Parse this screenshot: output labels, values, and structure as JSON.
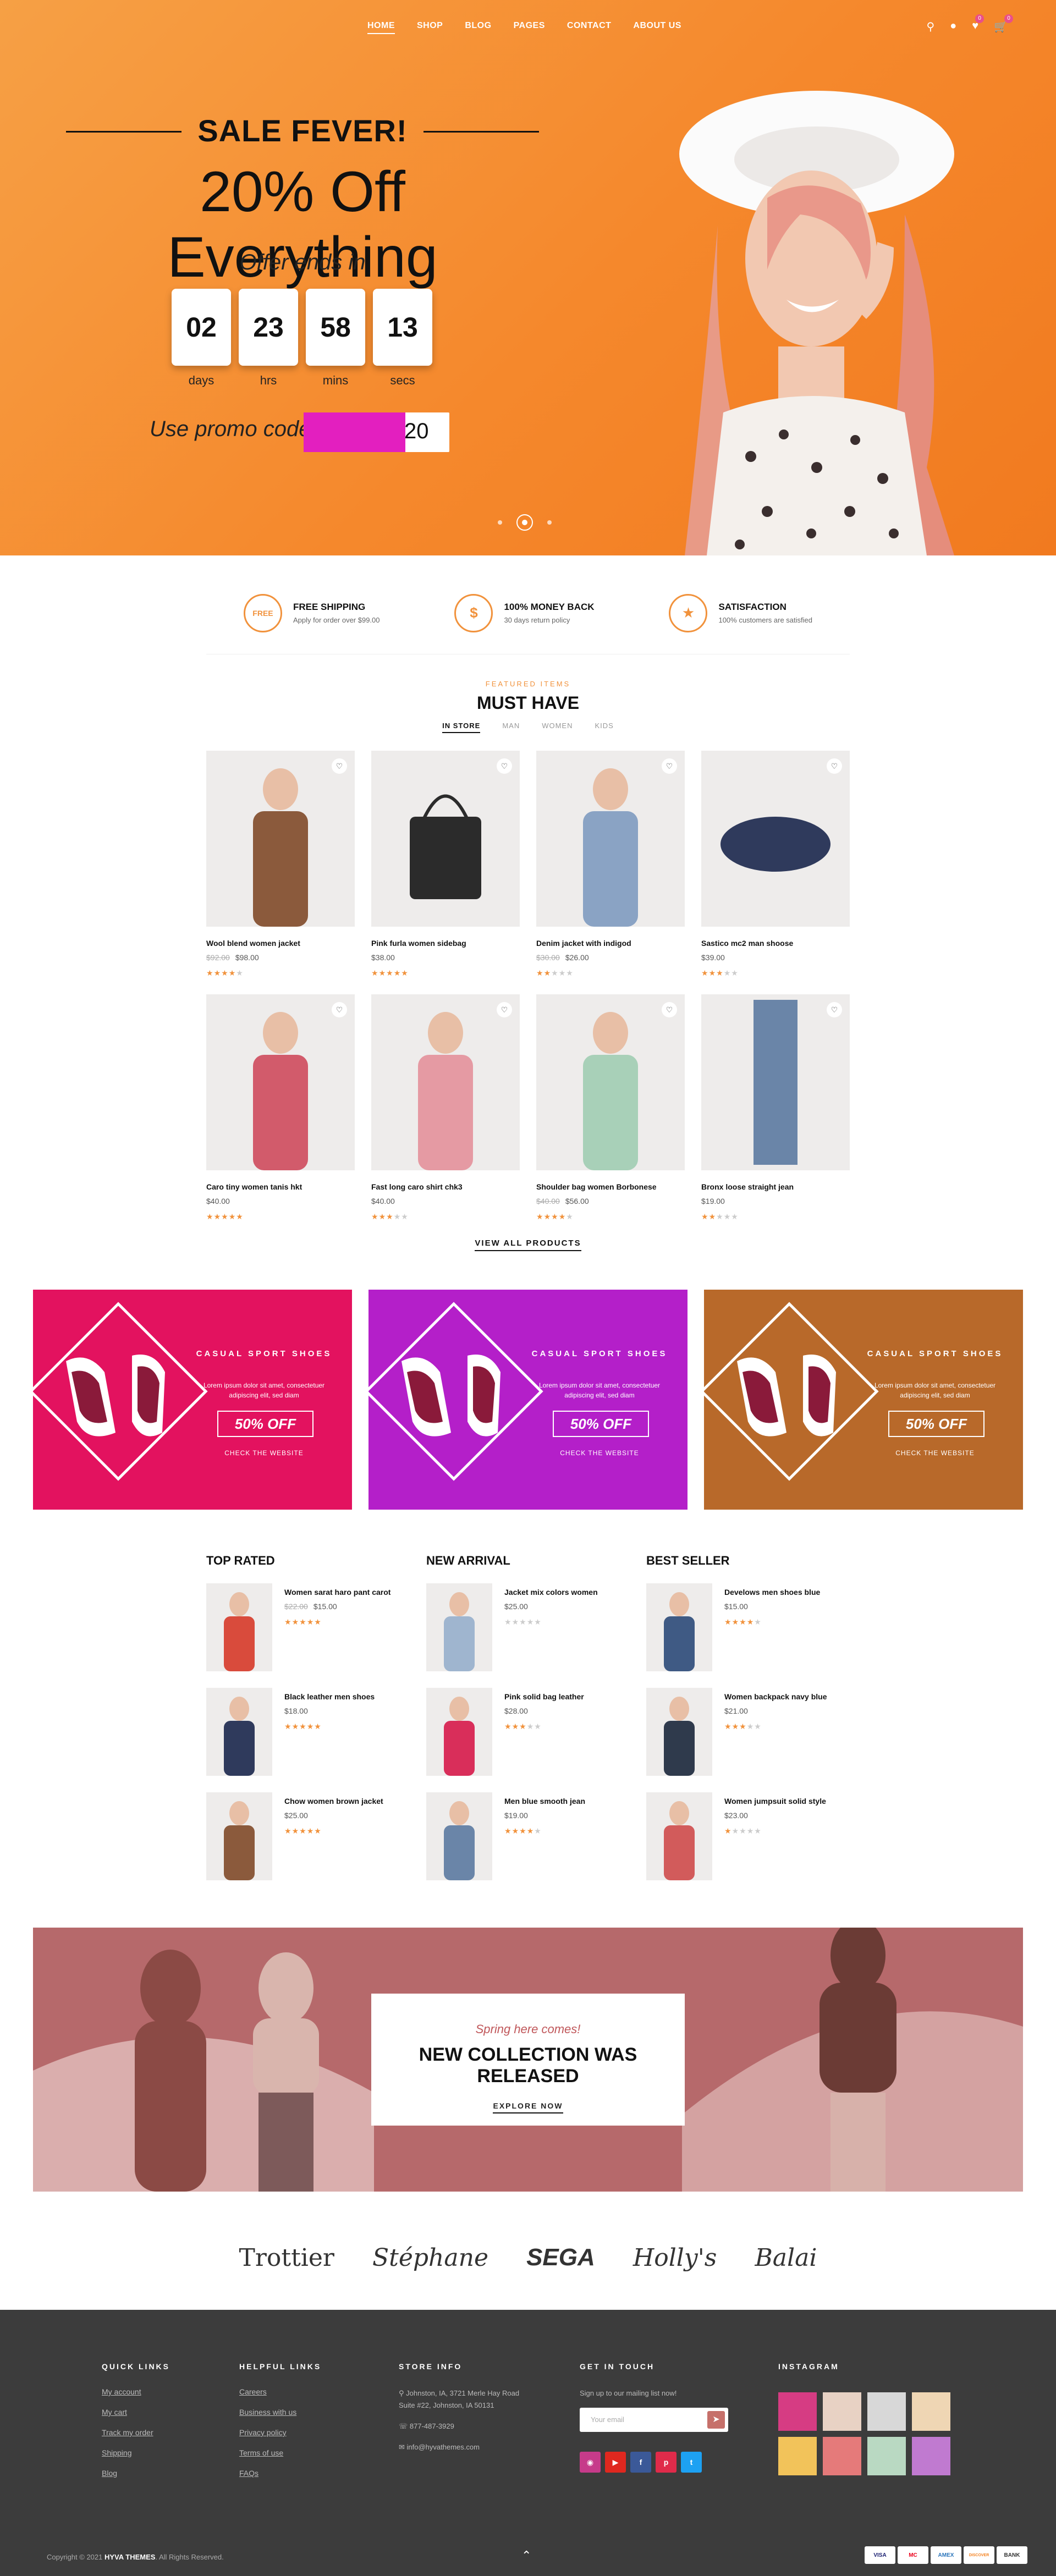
{
  "nav": {
    "links": [
      "HOME",
      "SHOP",
      "BLOG",
      "PAGES",
      "CONTACT",
      "ABOUT US"
    ],
    "cart_count": "0",
    "wish_count": "0"
  },
  "hero": {
    "title": "SALE FEVER!",
    "headline": "20% Off Everything",
    "offer": "Offer ends in",
    "countdown": [
      {
        "value": "02",
        "label": "days"
      },
      {
        "value": "23",
        "label": "hrs"
      },
      {
        "value": "58",
        "label": "mins"
      },
      {
        "value": "13",
        "label": "secs"
      }
    ],
    "promo_label": "Use promo code",
    "promo_value": "20"
  },
  "features": [
    {
      "title": "FREE SHIPPING",
      "sub": "Apply for order over $99.00",
      "icon": "FREE"
    },
    {
      "title": "100% MONEY BACK",
      "sub": "30 days return policy",
      "icon": "$"
    },
    {
      "title": "SATISFACTION",
      "sub": "100% customers are satisfied",
      "icon": "★"
    }
  ],
  "featured": {
    "sub": "FEATURED ITEMS",
    "title": "MUST HAVE",
    "tabs": [
      "IN STORE",
      "MAN",
      "WOMEN",
      "KIDS"
    ],
    "products": [
      {
        "name": "Wool blend women jacket",
        "old": "$92.00",
        "price": "$98.00",
        "rating": 4
      },
      {
        "name": "Pink furla women sidebag",
        "old": "",
        "price": "$38.00",
        "rating": 5
      },
      {
        "name": "Denim jacket with indigod",
        "old": "$30.00",
        "price": "$26.00",
        "rating": 2
      },
      {
        "name": "Sastico mc2 man shoose",
        "old": "",
        "price": "$39.00",
        "rating": 3
      },
      {
        "name": "Caro tiny women tanis hkt",
        "old": "",
        "price": "$40.00",
        "rating": 5
      },
      {
        "name": "Fast long caro shirt chk3",
        "old": "",
        "price": "$40.00",
        "rating": 3
      },
      {
        "name": "Shoulder bag women Borbonese",
        "old": "$40.00",
        "price": "$56.00",
        "rating": 4
      },
      {
        "name": "Bronx loose straight jean",
        "old": "",
        "price": "$19.00",
        "rating": 2
      }
    ],
    "view_all": "VIEW ALL PRODUCTS"
  },
  "banners": [
    {
      "kicker": "CASUAL SPORT SHOES",
      "text": "Lorem ipsum dolor sit amet, consectetuer adipiscing elit, sed diam",
      "pct": "50% OFF",
      "cta": "CHECK THE WEBSITE",
      "color": "#e3125f"
    },
    {
      "kicker": "CASUAL SPORT SHOES",
      "text": "Lorem ipsum dolor sit amet, consectetuer adipiscing elit, sed diam",
      "pct": "50% OFF",
      "cta": "CHECK THE WEBSITE",
      "color": "#b41fc9"
    },
    {
      "kicker": "CASUAL SPORT SHOES",
      "text": "Lorem ipsum dolor sit amet, consectetuer adipiscing elit, sed diam",
      "pct": "50% OFF",
      "cta": "CHECK THE WEBSITE",
      "color": "#b8692a"
    }
  ],
  "lists": [
    {
      "title": "TOP RATED",
      "items": [
        {
          "name": "Women sarat haro pant carot",
          "old": "$22.00",
          "price": "$15.00",
          "rating": 5
        },
        {
          "name": "Black leather men shoes",
          "old": "",
          "price": "$18.00",
          "rating": 5
        },
        {
          "name": "Chow women brown jacket",
          "old": "",
          "price": "$25.00",
          "rating": 5
        }
      ]
    },
    {
      "title": "NEW ARRIVAL",
      "items": [
        {
          "name": "Jacket mix colors women",
          "old": "",
          "price": "$25.00",
          "rating": 0
        },
        {
          "name": "Pink solid bag leather",
          "old": "",
          "price": "$28.00",
          "rating": 3
        },
        {
          "name": "Men blue smooth jean",
          "old": "",
          "price": "$19.00",
          "rating": 4
        }
      ]
    },
    {
      "title": "BEST SELLER",
      "items": [
        {
          "name": "Develows men shoes blue",
          "old": "",
          "price": "$15.00",
          "rating": 4
        },
        {
          "name": "Women backpack navy blue",
          "old": "",
          "price": "$21.00",
          "rating": 3
        },
        {
          "name": "Women jumpsuit solid style",
          "old": "",
          "price": "$23.00",
          "rating": 1
        }
      ]
    }
  ],
  "collection": {
    "kicker": "Spring here comes!",
    "title": "NEW COLLECTION WAS RELEASED",
    "cta": "EXPLORE NOW"
  },
  "brands": [
    "Trottier",
    "Stéphane",
    "SEGA",
    "Holly's",
    "Balai"
  ],
  "footer": {
    "quick": {
      "title": "QUICK LINKS",
      "links": [
        "My account",
        "My cart",
        "Track my order",
        "Shipping",
        "Blog"
      ]
    },
    "helpful": {
      "title": "HELPFUL LINKS",
      "links": [
        "Careers",
        "Business with us",
        "Privacy policy",
        "Terms of use",
        "FAQs"
      ]
    },
    "store": {
      "title": "STORE INFO",
      "address": "Johnston, IA, 3721 Merle Hay Road Suite #22, Johnston, IA 50131",
      "phone": "877-487-3929",
      "email": "info@hyvathemes.com"
    },
    "touch": {
      "title": "GET IN TOUCH",
      "text": "Sign up to our mailing list now!",
      "placeholder": "Your email"
    },
    "instagram": {
      "title": "INSTAGRAM"
    },
    "copyright_pre": "Copyright © 2021 ",
    "copyright_brand": "HYVA THEMES",
    "copyright_post": ". All Rights Reserved.",
    "payments": [
      "VISA",
      "MC",
      "AMEX",
      "DISCOVER",
      "BANK"
    ]
  }
}
